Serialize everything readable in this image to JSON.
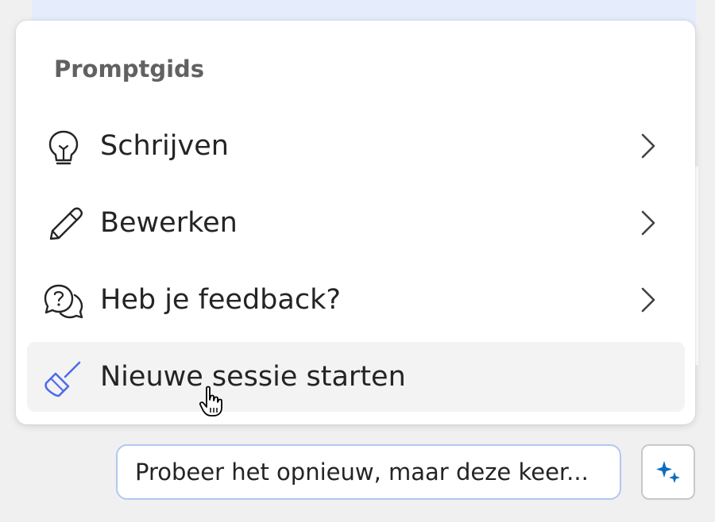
{
  "menu": {
    "header": "Promptgids",
    "items": [
      {
        "label": "Schrijven",
        "icon": "lightbulb-icon",
        "has_submenu": true
      },
      {
        "label": "Bewerken",
        "icon": "pencil-icon",
        "has_submenu": true
      },
      {
        "label": "Heb je feedback?",
        "icon": "feedback-chat-icon",
        "has_submenu": true
      },
      {
        "label": "Nieuwe sessie starten",
        "icon": "broom-icon",
        "has_submenu": false,
        "hovered": true
      }
    ]
  },
  "suggestion": {
    "label": "Probeer het opnieuw, maar deze keer..."
  },
  "sparkle_button": {
    "icon": "sparkle-icon"
  },
  "colors": {
    "accent": "#0f6cbd",
    "broom_blue": "#4f6bed",
    "pill_border": "#b4c7f0",
    "hover_bg": "#f3f3f3"
  }
}
